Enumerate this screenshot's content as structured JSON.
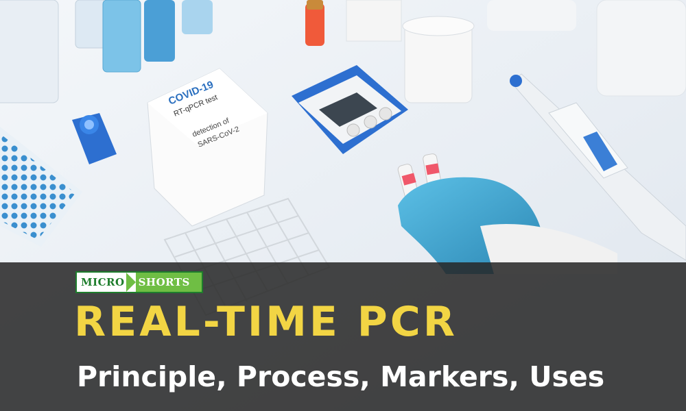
{
  "photo": {
    "box_title": "COVID-19",
    "box_subtitle": "RT-qPCR test",
    "box_line1": "detection of",
    "box_line2": "SARS-CoV-2"
  },
  "logo": {
    "left": "MICRO",
    "right": "SHORTS"
  },
  "title": "REAL-TIME PCR",
  "subtitle": "Principle, Process, Markers, Uses",
  "colors": {
    "overlay": "#262626",
    "title": "#f2d544",
    "subtitle": "#ffffff",
    "logo_green": "#1e7d2c",
    "logo_lightgreen": "#6fbe44",
    "glove": "#3aa3cf"
  }
}
